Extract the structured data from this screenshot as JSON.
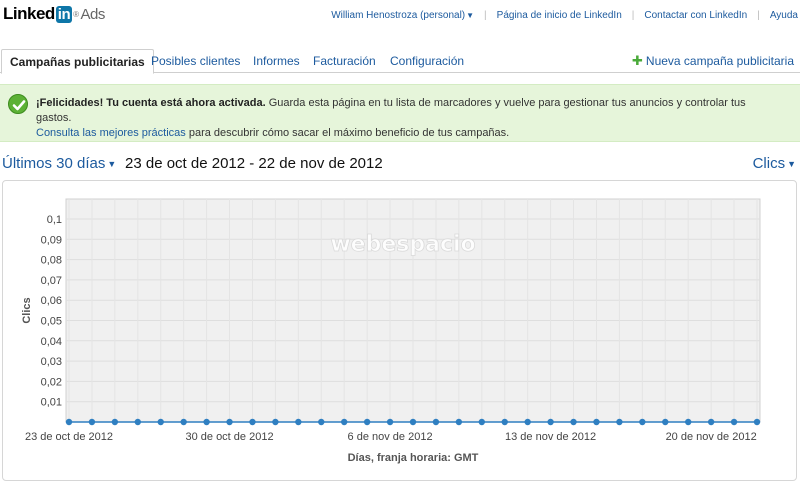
{
  "header": {
    "logo_text": "Linked",
    "logo_in": "in",
    "logo_reg": "®",
    "logo_product": "Ads",
    "user_menu": "William Henostroza (personal)",
    "links": [
      "Página de inicio de LinkedIn",
      "Contactar con LinkedIn",
      "Ayuda"
    ]
  },
  "tabs": [
    {
      "label": "Campañas publicitarias",
      "active": true
    },
    {
      "label": "Posibles clientes",
      "active": false
    },
    {
      "label": "Informes",
      "active": false
    },
    {
      "label": "Facturación",
      "active": false
    },
    {
      "label": "Configuración",
      "active": false
    }
  ],
  "new_campaign": {
    "icon": "plus-icon",
    "label": "Nueva campaña publicitaria"
  },
  "notice": {
    "icon": "check-icon",
    "bold": "¡Felicidades! Tu cuenta está ahora activada.",
    "text": " Guarda esta página en tu lista de marcadores y vuelve para gestionar tus anuncios y controlar tus gastos.",
    "link": "Consulta las mejores prácticas",
    "text2": " para descubrir cómo sacar el máximo beneficio de tus campañas."
  },
  "range": {
    "selector": "Últimos 30 días",
    "dates": "23 de oct de 2012 - 22 de nov de 2012",
    "metric_selector": "Clics"
  },
  "watermark": "webespacio",
  "colors": {
    "accent": "#1c5a9e",
    "line": "#2f7fc1",
    "notice_bg": "#e6f5da",
    "plot_bg": "#f0f0f0"
  },
  "chart_data": {
    "type": "line",
    "title": "",
    "xlabel": "Días, franja horaria: GMT",
    "ylabel": "Clics",
    "ylim": [
      0,
      0.1
    ],
    "yticks": [
      "0,1",
      "0,09",
      "0,08",
      "0,07",
      "0,06",
      "0,05",
      "0,04",
      "0,03",
      "0,02",
      "0,01"
    ],
    "xtick_labels": [
      "23 de oct de 2012",
      "30 de oct de 2012",
      "6 de nov de 2012",
      "13 de nov de 2012",
      "20 de nov de 2012"
    ],
    "xtick_index": [
      0,
      7,
      14,
      21,
      28
    ],
    "grid": true,
    "series": [
      {
        "name": "",
        "x": [
          "2012-10-23",
          "2012-10-24",
          "2012-10-25",
          "2012-10-26",
          "2012-10-27",
          "2012-10-28",
          "2012-10-29",
          "2012-10-30",
          "2012-10-31",
          "2012-11-01",
          "2012-11-02",
          "2012-11-03",
          "2012-11-04",
          "2012-11-05",
          "2012-11-06",
          "2012-11-07",
          "2012-11-08",
          "2012-11-09",
          "2012-11-10",
          "2012-11-11",
          "2012-11-12",
          "2012-11-13",
          "2012-11-14",
          "2012-11-15",
          "2012-11-16",
          "2012-11-17",
          "2012-11-18",
          "2012-11-19",
          "2012-11-20",
          "2012-11-21",
          "2012-11-22"
        ],
        "values": [
          0,
          0,
          0,
          0,
          0,
          0,
          0,
          0,
          0,
          0,
          0,
          0,
          0,
          0,
          0,
          0,
          0,
          0,
          0,
          0,
          0,
          0,
          0,
          0,
          0,
          0,
          0,
          0,
          0,
          0,
          0
        ]
      }
    ]
  }
}
